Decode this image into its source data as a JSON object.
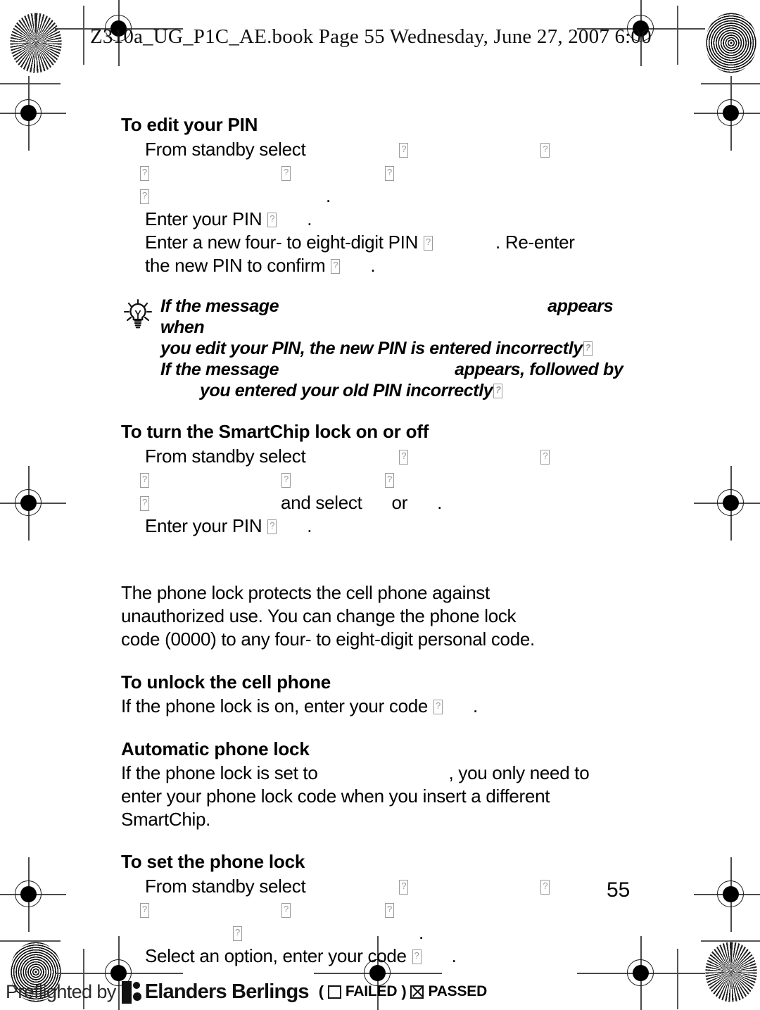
{
  "document": {
    "slugline": "Z310a_UG_P1C_AE.book  Page 55  Wednesday, June 27, 2007  6:00",
    "page_number": "55"
  },
  "sections": [
    {
      "heading": "To edit your PIN",
      "steps": [
        "From standby select",
        "",
        "Enter your PIN",
        "Enter a new four- to eight-digit PIN",
        ". Re-enter",
        "the new PIN to confirm"
      ]
    },
    {
      "heading": "To turn the SmartChip lock on or off",
      "steps": [
        "From standby select",
        "and select",
        "or",
        "Enter your PIN"
      ]
    },
    {
      "heading": "To unlock the cell phone",
      "steps": [
        "If the phone lock is on, enter your code"
      ]
    },
    {
      "heading": "Automatic phone lock",
      "steps": []
    },
    {
      "heading": "To set the phone lock",
      "steps": [
        "From standby select",
        "Select an option, enter your code"
      ]
    }
  ],
  "text": {
    "edit_pin_heading": "To edit your PIN",
    "from_standby_select": "From standby select",
    "enter_your_pin": "Enter your PIN",
    "enter_new_pin": "Enter a new four- to eight-digit PIN",
    "re_enter": ". Re-enter",
    "confirm_new_pin": "the new PIN to confirm",
    "period": ".",
    "tip_line1_a": "If the message",
    "tip_line1_b": "appears when",
    "tip_line2": "you edit your PIN, the new PIN is entered incorrectly",
    "tip_line3_a": "If the message",
    "tip_line3_b": "appears, followed by",
    "tip_line4": "you entered your old PIN incorrectly",
    "smartchip_lock_heading": "To turn the SmartChip lock on or off",
    "and_select": "and select",
    "or": "or",
    "phone_lock_body_line1": "The phone lock protects the cell phone against",
    "phone_lock_body_line2": "unauthorized use. You can change the phone lock",
    "phone_lock_body_line3": "code (0000) to any four- to eight-digit personal code.",
    "unlock_heading": "To unlock the cell phone",
    "unlock_body": "If the phone lock is on, enter your code",
    "auto_lock_heading": "Automatic phone lock",
    "auto_lock_line1_a": "If the phone lock is set to",
    "auto_lock_line1_b": ", you only need to",
    "auto_lock_line2": "enter your phone lock code when you insert a different",
    "auto_lock_line3": "SmartChip.",
    "set_lock_heading": "To set the phone lock",
    "set_lock_step2": "Select an option, enter your code"
  },
  "preflight": {
    "label": "Preflighted by",
    "brand": "Elanders Berlings",
    "paren_open": "(",
    "failed_label": "FAILED",
    "paren_close": ")",
    "passed_label": "PASSED"
  },
  "icons": {
    "tip": "lightbulb-icon",
    "registration": "registration-mark-icon",
    "rosette_radial": "radial-rosette-icon",
    "rosette_concentric": "concentric-rosette-icon",
    "logo": "elanders-logo-icon"
  },
  "colors": {
    "ink": "#000000",
    "paper": "#ffffff",
    "mark_gray": "#4a4a4a",
    "tofu_gray": "#9a9a9a"
  }
}
